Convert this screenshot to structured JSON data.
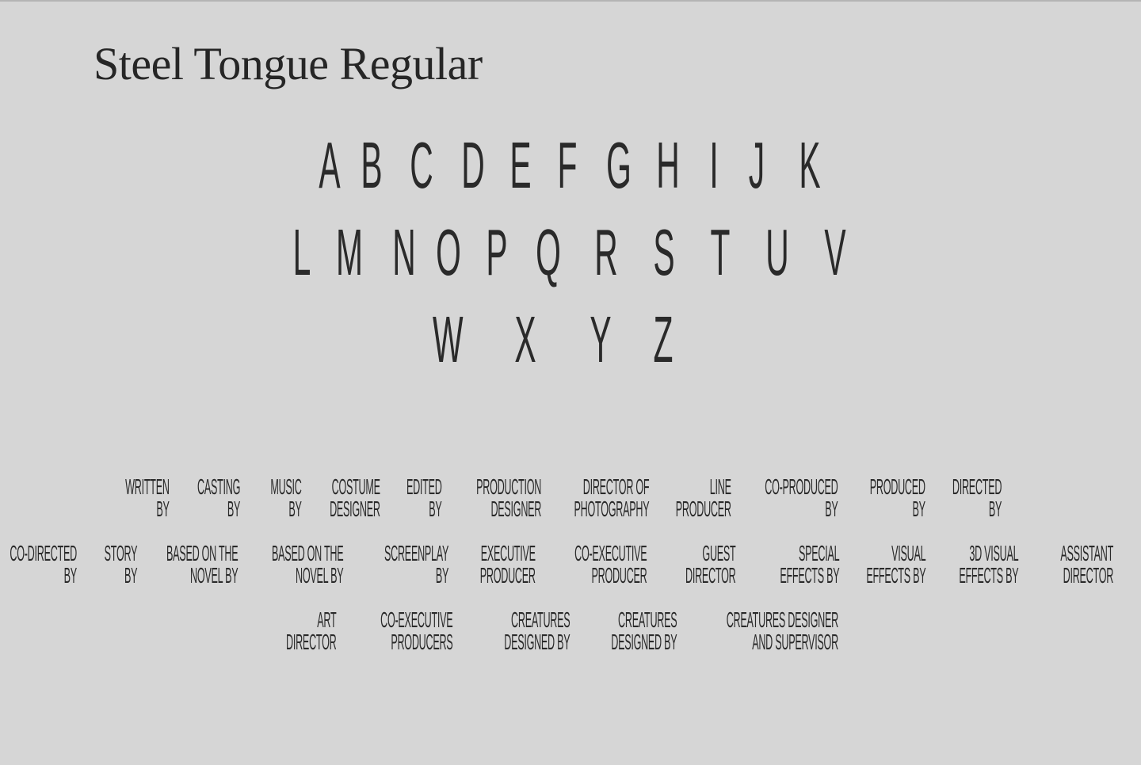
{
  "title": "Steel Tongue Regular",
  "alphabet_rows": [
    [
      "A",
      "B",
      "C",
      "D",
      "E",
      "F",
      "G",
      "H",
      "I",
      "J",
      "K"
    ],
    [
      "L",
      "M",
      "N",
      "O",
      "P",
      "Q",
      "R",
      "S",
      "T",
      "U",
      "V"
    ],
    [
      "W",
      "X",
      "Y",
      "Z"
    ]
  ],
  "credit_rows": [
    [
      [
        "WRITTEN",
        "BY"
      ],
      [
        "CASTING",
        "BY"
      ],
      [
        "MUSIC",
        "BY"
      ],
      [
        "COSTUME",
        "DESIGNER"
      ],
      [
        "EDITED",
        "BY"
      ],
      [
        "PRODUCTION",
        "DESIGNER"
      ],
      [
        "DIRECTOR OF",
        "PHOTOGRAPHY"
      ],
      [
        "LINE",
        "PRODUCER"
      ],
      [
        "CO-PRODUCED",
        "BY"
      ],
      [
        "PRODUCED",
        "BY"
      ],
      [
        "DIRECTED",
        "BY"
      ]
    ],
    [
      [
        "CO-DIRECTED",
        "BY"
      ],
      [
        "STORY",
        "BY"
      ],
      [
        "BASED ON THE",
        "NOVEL BY"
      ],
      [
        "BASED ON THE",
        "NOVEL BY"
      ],
      [
        "SCREENPLAY",
        "BY"
      ],
      [
        "EXECUTIVE",
        "PRODUCER"
      ],
      [
        "CO-EXECUTIVE",
        "PRODUCER"
      ],
      [
        "GUEST",
        "DIRECTOR"
      ],
      [
        "SPECIAL",
        "EFFECTS BY"
      ],
      [
        "VISUAL",
        "EFFECTS BY"
      ],
      [
        "3D VISUAL",
        "EFFECTS BY"
      ],
      [
        "ASSISTANT",
        "DIRECTOR"
      ]
    ],
    [
      [
        "ART",
        "DIRECTOR"
      ],
      [
        "CO-EXECUTIVE",
        "PRODUCERS"
      ],
      [
        "CREATURES",
        "DESIGNED BY"
      ],
      [
        "CREATURES",
        "DESIGNED BY"
      ],
      [
        "CREATURES DESIGNER",
        "AND SUPERVISOR"
      ]
    ]
  ]
}
